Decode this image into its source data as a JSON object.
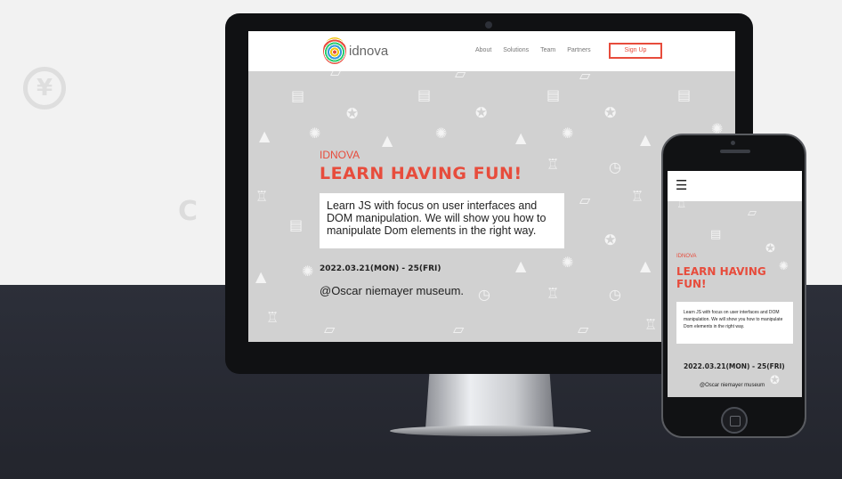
{
  "desktop": {
    "nav": {
      "brand": "idnova",
      "links": [
        "About",
        "Solutions",
        "Team",
        "Partners"
      ],
      "signup": "Sign Up"
    },
    "hero": {
      "eyebrow": "IDNOVA",
      "title": "LEARN HAVING FUN!",
      "description": "Learn JS with focus on user interfaces and DOM manipulation. We will show you how to manipulate Dom elements in the right way.",
      "date": "2022.03.21(MON) - 25(FRI)",
      "location": "@Oscar niemayer museum."
    }
  },
  "mobile": {
    "hero": {
      "eyebrow": "IDNOVA",
      "title": "LEARN HAVING FUN!",
      "description": "Learn JS with focus on user interfaces and DOM manipulation. We will show you how to manipulate Dom elements in the right way.",
      "date": "2022.03.21(MON) - 25(FRI)",
      "location": "@Oscar niemayer museum"
    }
  },
  "icons": [
    "yen-coin-icon",
    "c-letter-icon",
    "clipboard-icon",
    "award-ribbon-icon",
    "graduation-cap-icon",
    "light-bulb-icon",
    "trophy-icon",
    "book-icon",
    "clock-icon",
    "hamburger-menu-icon"
  ],
  "colors": {
    "accent": "#e74c3c",
    "hero_background": "#d1d1d1",
    "page_top": "#f2f2f2",
    "page_bottom": "#2c2f39"
  }
}
